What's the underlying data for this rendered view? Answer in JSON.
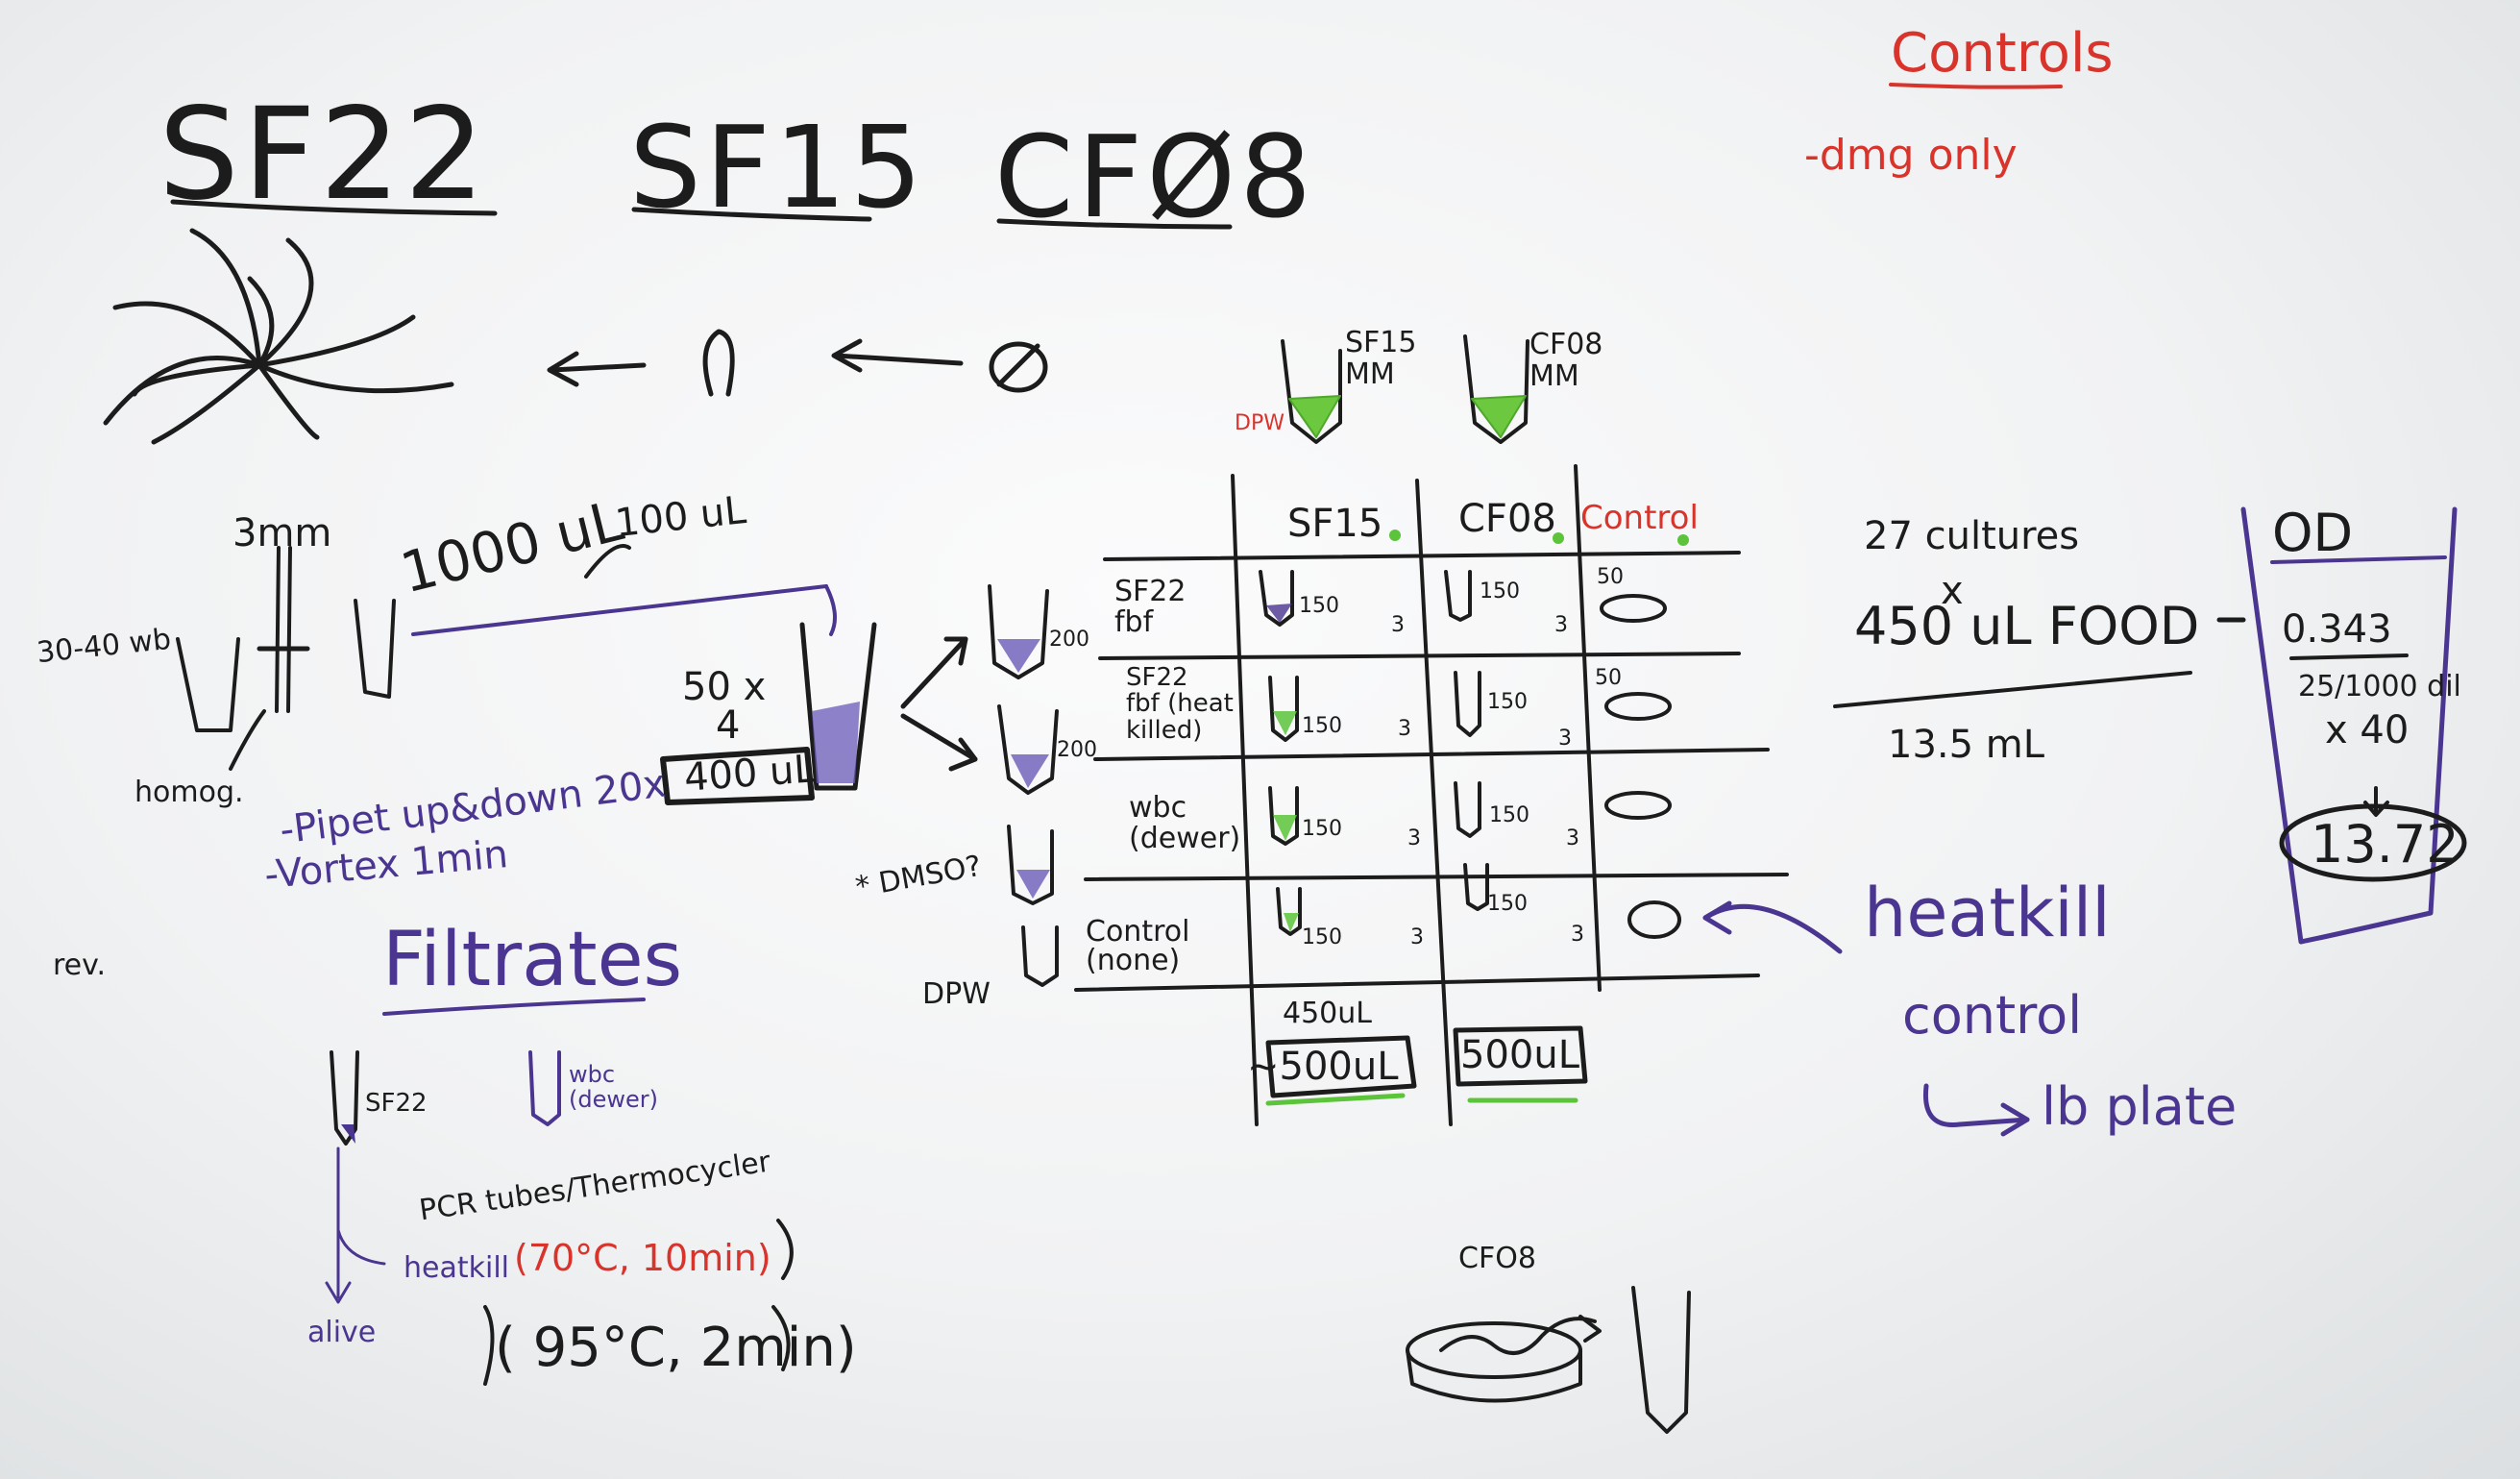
{
  "headings": {
    "sf22": "SF22",
    "sf15": "SF15",
    "cf08": "CFØ8",
    "controls": "Controls",
    "dmg_only": "-dmg only"
  },
  "tubes_top": {
    "sf15_mm": "SF15\nMM",
    "cf08_mm": "CF08\nMM",
    "dpw": "DPW"
  },
  "prep": {
    "mm3": "3mm",
    "worms": "30-40 wb",
    "homog": "homog.",
    "volume_1000": "1000 uL",
    "volume_100": "100 uL",
    "fifty_x": "50 x",
    "four": "4",
    "four_hundred": "400 uL",
    "pipet": "-Pipet up&down 20x",
    "vortex": "-Vortex 1min",
    "rev": "rev.",
    "dmso": "* DMSO?",
    "dpw_left": "DPW",
    "two_hundred_a": "200",
    "two_hundred_b": "200"
  },
  "filtrates": {
    "title": "Filtrates",
    "sf22": "SF22",
    "wbc": "wbc\n(dewer)",
    "pcr": "PCR tubes/Thermocycler",
    "heatkill": "heatkill",
    "cond1": "(70°C, 10min)",
    "alive": "alive",
    "cond2": "( 95°C, 2min)"
  },
  "table": {
    "col_headers": [
      "SF15",
      "CF08",
      "Control"
    ],
    "rows": [
      {
        "label": "SF22\nfbf",
        "sf15": "150",
        "cf08": "150",
        "ctrl": "50",
        "n1": "3",
        "n2": "3"
      },
      {
        "label": "SF22\nfbf (heat\nkilled)",
        "sf15": "150",
        "cf08": "150",
        "ctrl": "50",
        "n1": "3",
        "n2": "3"
      },
      {
        "label": "wbc\n(dewer)",
        "sf15": "150",
        "cf08": "150",
        "ctrl": "",
        "n1": "3",
        "n2": "3"
      },
      {
        "label": "Control\n(none)",
        "sf15": "150",
        "cf08": "150",
        "ctrl": "",
        "n1": "3",
        "n2": "3"
      }
    ],
    "bottom_sf15_a": "450uL",
    "bottom_sf15_b": "~500uL",
    "bottom_cf08": "500uL"
  },
  "right": {
    "cultures": "27 cultures",
    "times": "x",
    "food": "450 uL FOOD",
    "total": "13.5 mL",
    "od": "OD",
    "od_val": "0.343",
    "dil": "25/1000 dil",
    "x40": "x 40",
    "result": "13.72",
    "heatkill": "heatkill",
    "control": "control",
    "lb_plate": "lb plate"
  },
  "bottom": {
    "cf08": "CFO8"
  },
  "colors": {
    "board": "#f4f5f6",
    "black_marker": "#1c1c1c",
    "red_marker": "#d8342c",
    "purple_marker": "#4a3590",
    "green_marker": "#5cc43a"
  }
}
